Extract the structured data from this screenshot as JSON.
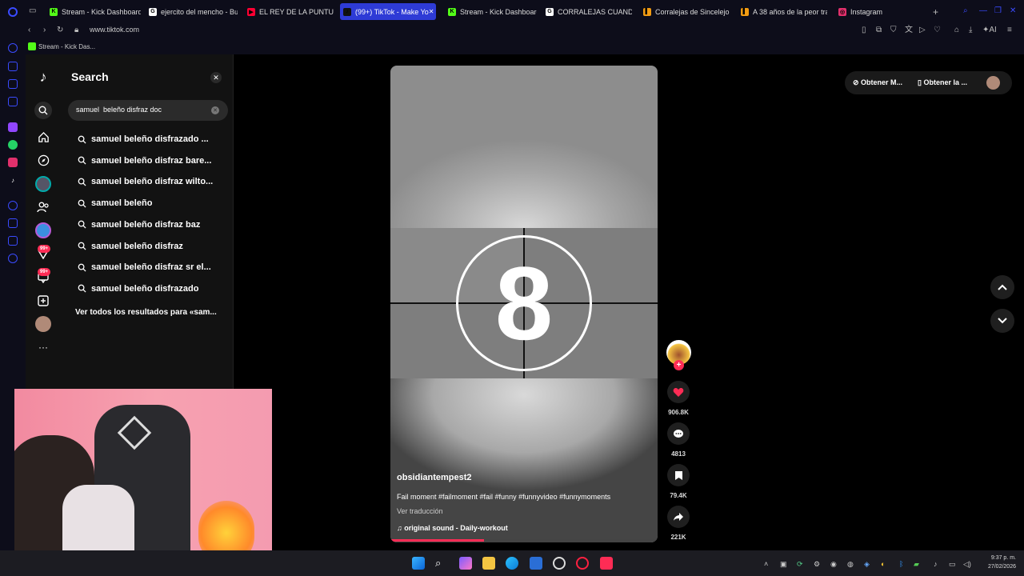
{
  "browser": {
    "tabs": [
      {
        "label": "Stream - Kick Dashboard",
        "fav": "#53fc18",
        "glyph": "K"
      },
      {
        "label": "ejercito del mencho - Bu",
        "fav": "#ffffff",
        "glyph": "G"
      },
      {
        "label": "EL REY DE LA PUNTUALI",
        "fav": "#ff0033",
        "glyph": "▶"
      },
      {
        "label": "(99+) TikTok - Make Yo",
        "fav": "#111111",
        "glyph": "♪",
        "active": true
      },
      {
        "label": "Stream - Kick Dashboard",
        "fav": "#53fc18",
        "glyph": "K"
      },
      {
        "label": "CORRALEJAS CUANDO",
        "fav": "#ffffff",
        "glyph": "G"
      },
      {
        "label": "Corralejas de Sincelejo, ",
        "fav": "#f39c12",
        "glyph": "▌"
      },
      {
        "label": "A 38 años de la peor tra",
        "fav": "#f39c12",
        "glyph": "▌"
      },
      {
        "label": "Instagram",
        "fav": "#e1306c",
        "glyph": "◎"
      }
    ],
    "url": "www.tiktok.com",
    "bookmark": "Stream - Kick Das..."
  },
  "tiktok": {
    "search_title": "Search",
    "search_value": "samuel  beleño disfraz doc",
    "suggestions": [
      "samuel beleño disfrazado ...",
      "samuel beleño disfraz bare...",
      "samuel beleño disfraz wilto...",
      "samuel beleño",
      "samuel beleño disfraz baz",
      "samuel beleño disfraz",
      "samuel beleño disfraz sr el...",
      "samuel beleño disfrazado"
    ],
    "see_all": "Ver todos los resultados para «sam...",
    "badge_inbox": "99+",
    "badge_msg": "99+",
    "top_btn1": "Obtener M...",
    "top_btn2": "Obtener la ...",
    "video": {
      "countdown": "8",
      "author": "obsidiantempest2",
      "caption": "Fail moment #failmoment #fail #funny #funnyvideo #funnymoments",
      "translate": "Ver traducción",
      "sound": "original sound - Daily-workout",
      "progress_fraction": 0.35
    },
    "actions": {
      "likes": "906.8K",
      "comments": "4813",
      "saves": "79.4K",
      "shares": "221K"
    }
  },
  "taskbar": {
    "time": "9:37 p. m.",
    "date": "27/02/2026"
  },
  "colors": {
    "accent": "#fe2c55",
    "tab_active": "#2e3bd6",
    "kick": "#53fc18"
  }
}
